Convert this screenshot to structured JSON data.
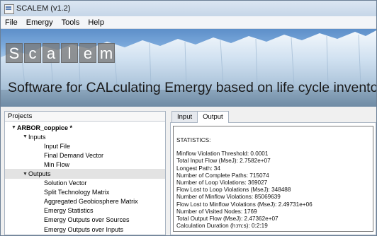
{
  "window": {
    "title": "SCALEM (v1.2)"
  },
  "menu": [
    "File",
    "Emergy",
    "Tools",
    "Help"
  ],
  "banner": {
    "logo_letters": [
      "S",
      "c",
      "a",
      "l",
      "e",
      "m"
    ],
    "tagline": "Software for CALculating Emergy based on life cycle inventories"
  },
  "projects": {
    "header": "Projects",
    "root": {
      "label": "ARBOR_coppice *",
      "toggle": "▼"
    },
    "inputs": {
      "label": "Inputs",
      "toggle": "▼",
      "items": [
        "Input File",
        "Final Demand Vector",
        "Min Flow"
      ]
    },
    "outputs": {
      "label": "Outputs",
      "toggle": "▼",
      "items": [
        "Solution Vector",
        "Split Technology Matrix",
        "Aggregated Geobiosphere Matrix",
        "Emergy Statistics",
        "Emergy Outputs over Sources",
        "Emergy Outputs over Inputs"
      ]
    }
  },
  "tabs": [
    "Input",
    "Output"
  ],
  "active_tab": "Output",
  "output": {
    "heading": "STATISTICS:",
    "lines": [
      "Minflow Violation Threshold: 0.0001",
      "Total Input Flow (MseJ): 2.7582e+07",
      "Longest Path: 34",
      "Number of Complete Paths: 715074",
      "Number of Loop Violations: 369027",
      "Flow Lost to Loop Violations (MseJ): 348488",
      "Number of Minflow Violations: 85069639",
      "Flow Lost to Minflow Violations (MseJ): 2.49731e+06",
      "Number of Visited Nodes: 1769",
      "Total Output Flow (MseJ): 2.47362e+07",
      "Calculation Duration (h:m:s): 0:2:19"
    ]
  }
}
